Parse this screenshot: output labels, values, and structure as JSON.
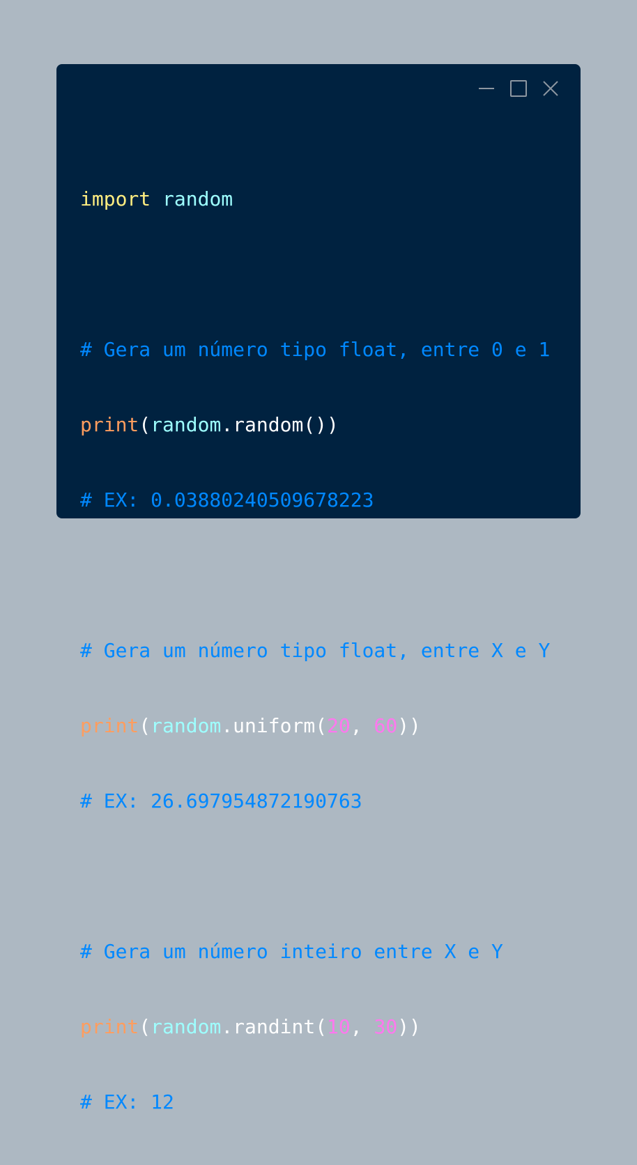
{
  "window": {
    "controls": {
      "minimize_icon": "minimize-icon",
      "maximize_icon": "maximize-icon",
      "close_icon": "close-icon"
    }
  },
  "colors": {
    "background": "#adb8c2",
    "window": "#002240",
    "keyword": "#ffee80",
    "module": "#9effff",
    "comment": "#0088ff",
    "builtin": "#ff9d5e",
    "number": "#ff77ee",
    "text": "#ffffff"
  },
  "code": {
    "import_kw": "import",
    "import_module": "random",
    "comment1": "# Gera um número tipo float, entre 0 e 1",
    "print1_fn": "print",
    "print1_module": "random",
    "print1_method": "random",
    "example1": "# EX: 0.03880240509678223",
    "comment2": "# Gera um número tipo float, entre X e Y",
    "print2_fn": "print",
    "print2_module": "random",
    "print2_method": "uniform",
    "print2_arg1": "20",
    "print2_arg2": "60",
    "example2": "# EX: 26.697954872190763",
    "comment3": "# Gera um número inteiro entre X e Y",
    "print3_fn": "print",
    "print3_module": "random",
    "print3_method": "randint",
    "print3_arg1": "10",
    "print3_arg2": "30",
    "example3": "# EX: 12"
  }
}
